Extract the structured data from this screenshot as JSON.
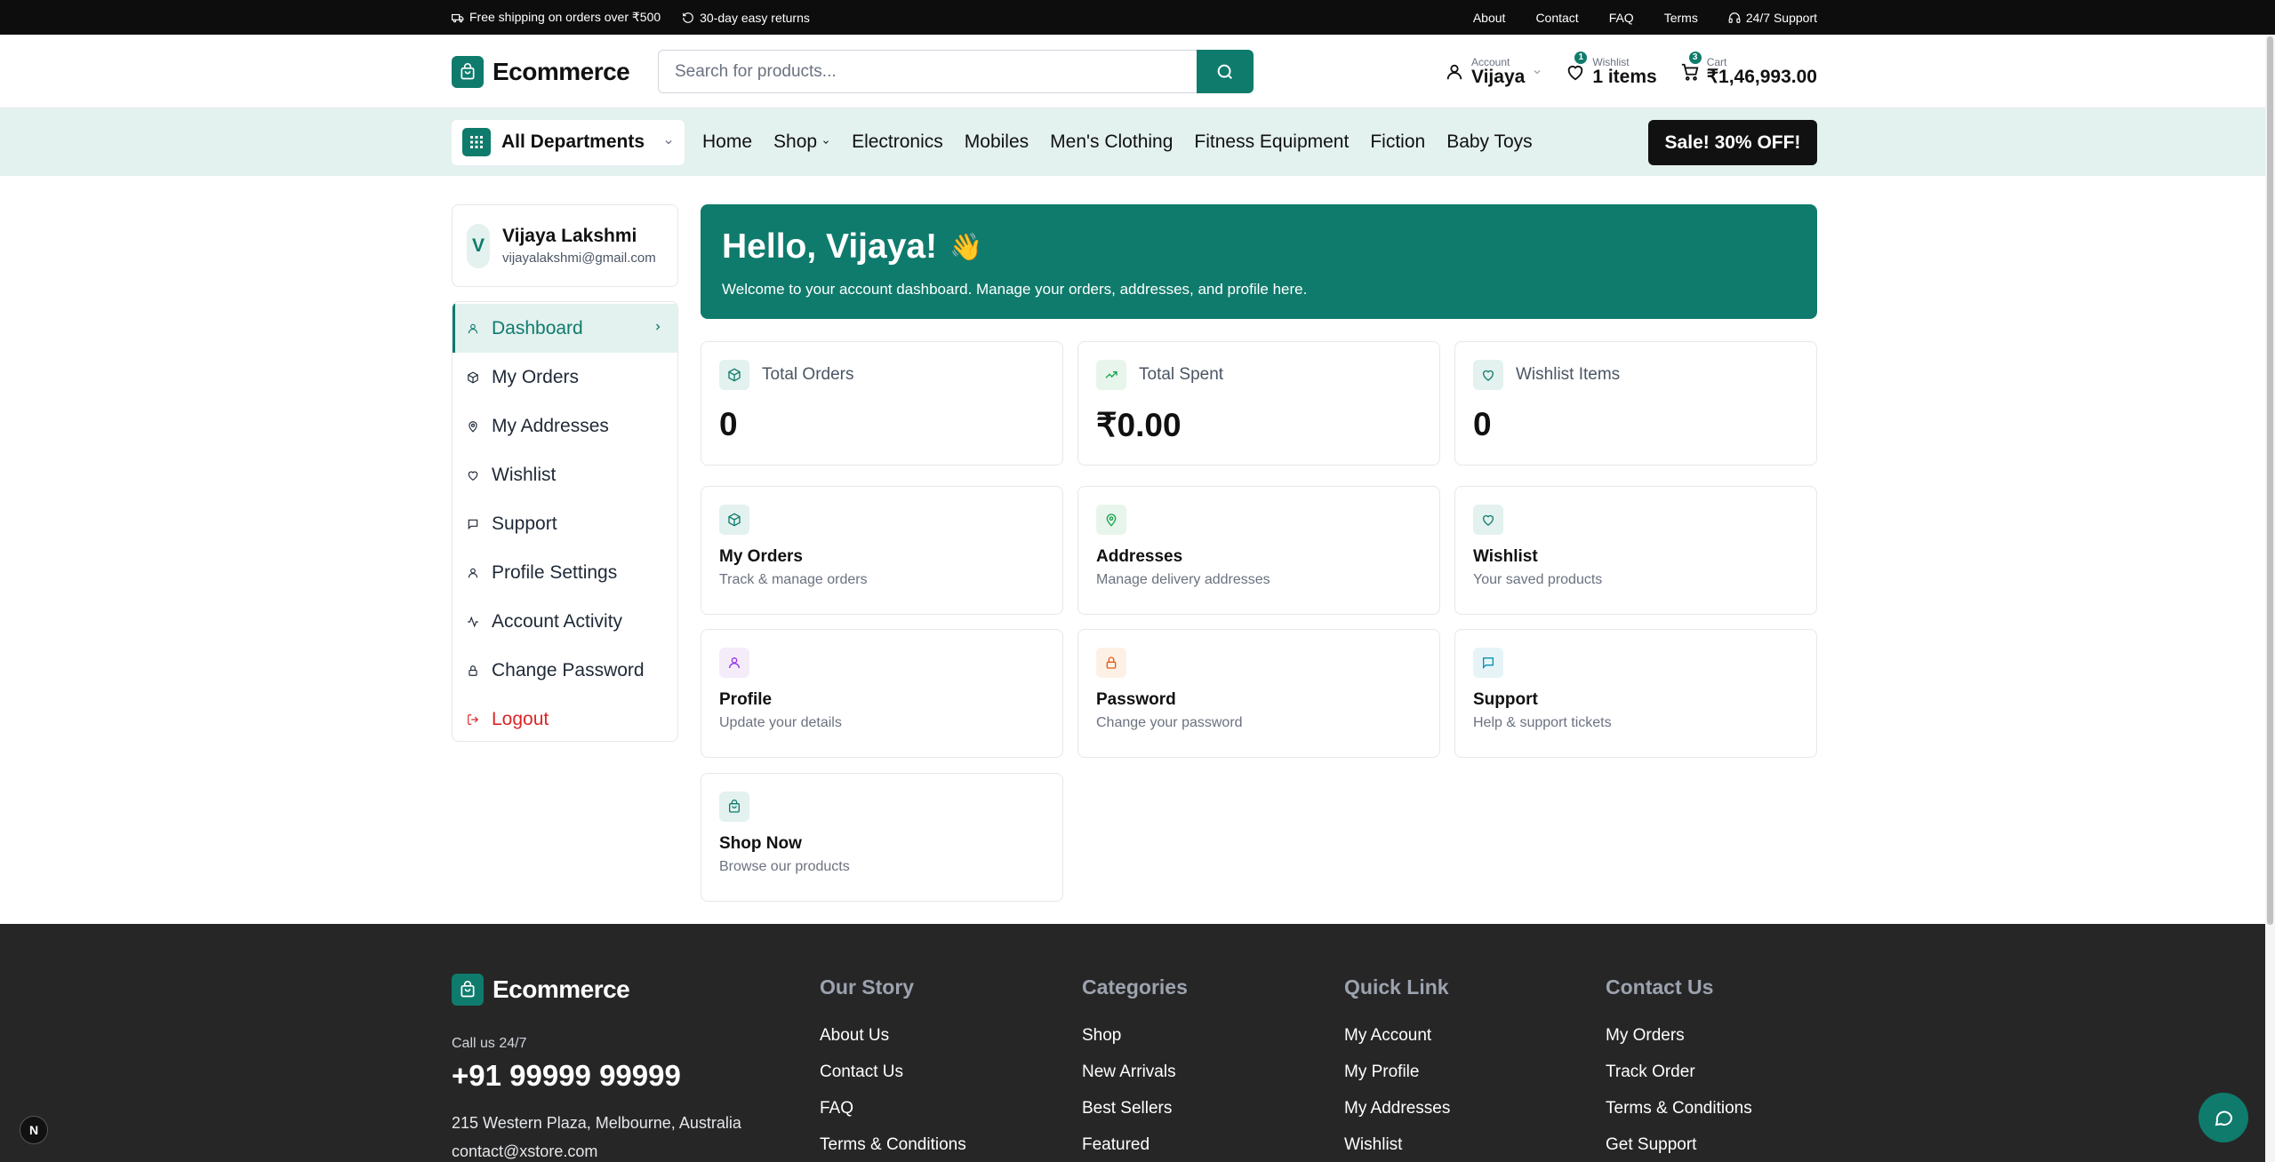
{
  "topbar": {
    "shipping": "Free shipping on orders over ₹500",
    "returns": "30-day easy returns",
    "links": [
      "About",
      "Contact",
      "FAQ",
      "Terms"
    ],
    "support": "24/7 Support"
  },
  "header": {
    "logo": "Ecommerce",
    "search_placeholder": "Search for products...",
    "account_small": "Account",
    "account_name": "Vijaya",
    "wishlist_small": "Wishlist",
    "wishlist_value": "1 items",
    "wishlist_badge": "1",
    "cart_small": "Cart",
    "cart_value": "₹1,46,993.00",
    "cart_badge": "3"
  },
  "nav": {
    "departments": "All Departments",
    "links": [
      "Home",
      "Shop",
      "Electronics",
      "Mobiles",
      "Men's Clothing",
      "Fitness Equipment",
      "Fiction",
      "Baby Toys"
    ],
    "sale": "Sale! 30% OFF!"
  },
  "user": {
    "initial": "V",
    "name": "Vijaya Lakshmi",
    "email": "vijayalakshmi@gmail.com"
  },
  "sidebar": {
    "items": [
      "Dashboard",
      "My Orders",
      "My Addresses",
      "Wishlist",
      "Support",
      "Profile Settings",
      "Account Activity",
      "Change Password",
      "Logout"
    ]
  },
  "hello": {
    "title": "Hello, Vijaya!",
    "emoji": "👋",
    "subtitle": "Welcome to your account dashboard. Manage your orders, addresses, and profile here."
  },
  "stats": [
    {
      "label": "Total Orders",
      "value": "0"
    },
    {
      "label": "Total Spent",
      "value": "₹0.00"
    },
    {
      "label": "Wishlist Items",
      "value": "0"
    }
  ],
  "links": [
    {
      "title": "My Orders",
      "sub": "Track & manage orders"
    },
    {
      "title": "Addresses",
      "sub": "Manage delivery addresses"
    },
    {
      "title": "Wishlist",
      "sub": "Your saved products"
    },
    {
      "title": "Profile",
      "sub": "Update your details"
    },
    {
      "title": "Password",
      "sub": "Change your password"
    },
    {
      "title": "Support",
      "sub": "Help & support tickets"
    },
    {
      "title": "Shop Now",
      "sub": "Browse our products"
    }
  ],
  "footer": {
    "logo": "Ecommerce",
    "call_label": "Call us 24/7",
    "phone": "+91 99999 99999",
    "address": "215 Western Plaza, Melbourne, Australia",
    "email": "contact@xstore.com",
    "columns": [
      {
        "title": "Our Story",
        "links": [
          "About Us",
          "Contact Us",
          "FAQ",
          "Terms & Conditions"
        ]
      },
      {
        "title": "Categories",
        "links": [
          "Shop",
          "New Arrivals",
          "Best Sellers",
          "Featured"
        ]
      },
      {
        "title": "Quick Link",
        "links": [
          "My Account",
          "My Profile",
          "My Addresses",
          "Wishlist"
        ]
      },
      {
        "title": "Contact Us",
        "links": [
          "My Orders",
          "Track Order",
          "Terms & Conditions",
          "Get Support"
        ]
      }
    ]
  },
  "misc": {
    "n_badge": "N"
  },
  "colors": {
    "brand": "#0f7b6c",
    "nav_bg": "#e3f1ef",
    "danger": "#dc2626",
    "footer_bg": "#262626"
  }
}
